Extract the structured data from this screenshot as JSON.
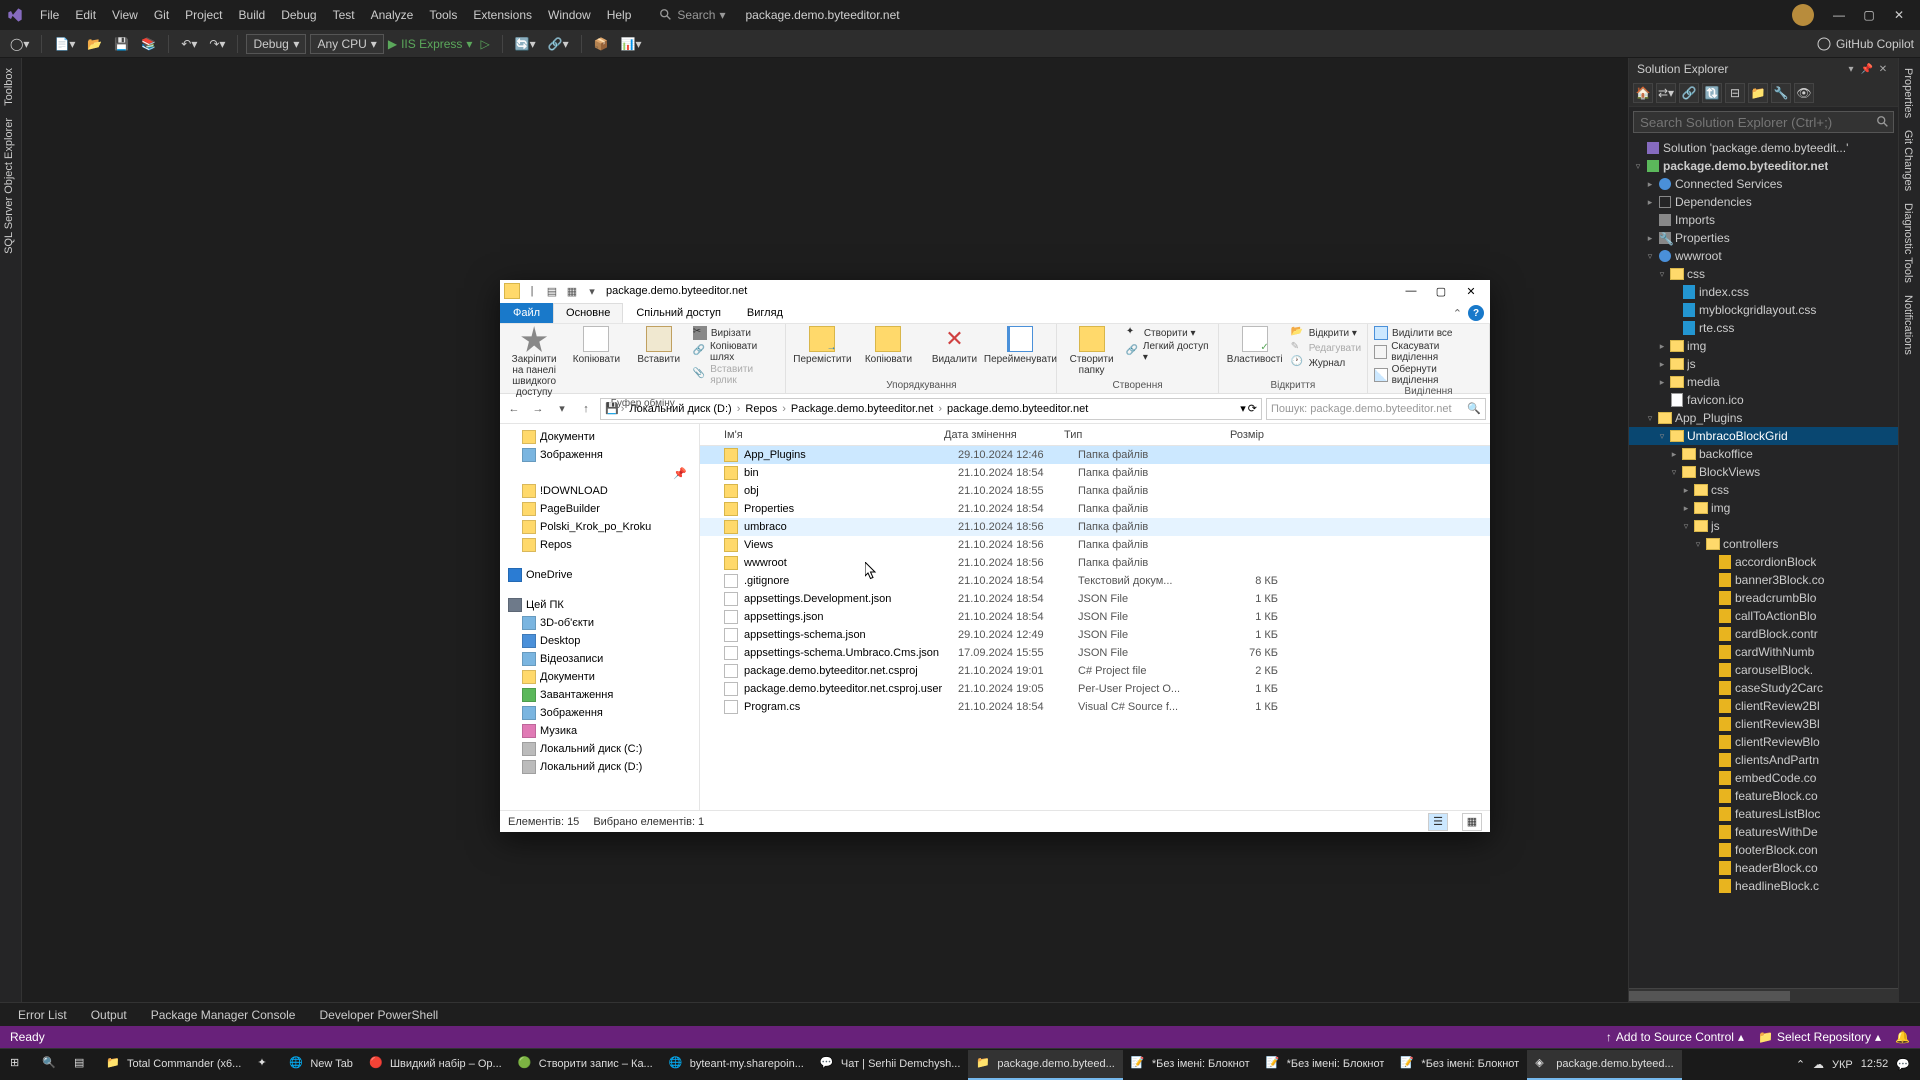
{
  "titlebar": {
    "menu": [
      "File",
      "Edit",
      "View",
      "Git",
      "Project",
      "Build",
      "Debug",
      "Test",
      "Analyze",
      "Tools",
      "Extensions",
      "Window",
      "Help"
    ],
    "search_label": "Search",
    "doc_title": "package.demo.byteeditor.net"
  },
  "toolbar": {
    "config": "Debug",
    "platform": "Any CPU",
    "run_target": "IIS Express",
    "copilot": "GitHub Copilot"
  },
  "left_tabs": [
    "Toolbox",
    "SQL Server Object Explorer"
  ],
  "right_tabs": [
    "Properties",
    "Git Changes",
    "Diagnostic Tools",
    "Notifications"
  ],
  "solexp": {
    "title": "Solution Explorer",
    "search_placeholder": "Search Solution Explorer (Ctrl+;)",
    "root": "Solution 'package.demo.byteedit...'",
    "project": "package.demo.byteeditor.net",
    "nodes": {
      "connected": "Connected Services",
      "deps": "Dependencies",
      "imports": "Imports",
      "properties": "Properties",
      "wwwroot": "wwwroot",
      "css": "css",
      "css_files": [
        "index.css",
        "myblockgridlayout.css",
        "rte.css"
      ],
      "img": "img",
      "js": "js",
      "media": "media",
      "favicon": "favicon.ico",
      "app_plugins": "App_Plugins",
      "umbraco_block": "UmbracoBlockGrid",
      "backoffice": "backoffice",
      "blockviews": "BlockViews",
      "bv_css": "css",
      "bv_img": "img",
      "bv_js": "js",
      "controllers": "controllers",
      "ctrl_files": [
        "accordionBlock",
        "banner3Block.co",
        "breadcrumbBlo",
        "callToActionBlo",
        "cardBlock.contr",
        "cardWithNumb",
        "carouselBlock.",
        "caseStudy2Carc",
        "clientReview2Bl",
        "clientReview3Bl",
        "clientReviewBlo",
        "clientsAndPartn",
        "embedCode.co",
        "featureBlock.co",
        "featuresListBloc",
        "featuresWithDe",
        "footerBlock.con",
        "headerBlock.co",
        "headlineBlock.c"
      ]
    }
  },
  "bottom_tabs": [
    "Error List",
    "Output",
    "Package Manager Console",
    "Developer PowerShell"
  ],
  "statusbar": {
    "ready": "Ready",
    "add_source": "Add to Source Control",
    "select_repo": "Select Repository"
  },
  "explorer": {
    "title": "package.demo.byteeditor.net",
    "tabs": {
      "file": "Файл",
      "home": "Основне",
      "share": "Спільний доступ",
      "view": "Вигляд"
    },
    "ribbon": {
      "g1": {
        "pin": "Закріпити на панелі\nшвидкого доступу",
        "copy": "Копіювати",
        "paste": "Вставити",
        "cut": "Вирізати",
        "copypath": "Копіювати шлях",
        "pasteshort": "Вставити ярлик",
        "name": "Буфер обміну"
      },
      "g2": {
        "move": "Перемістити",
        "copyto": "Копіювати",
        "delete": "Видалити",
        "rename": "Перейменувати",
        "name": "Упорядкування"
      },
      "g3": {
        "newfolder": "Створити\nпапку",
        "newitem": "Створити ▾",
        "easy": "Легкий доступ ▾",
        "name": "Створення"
      },
      "g4": {
        "props": "Властивості",
        "open": "Відкрити ▾",
        "edit": "Редагувати",
        "history": "Журнал",
        "name": "Відкриття"
      },
      "g5": {
        "selall": "Виділити все",
        "selnone": "Скасувати виділення",
        "selinv": "Обернути виділення",
        "name": "Виділення"
      }
    },
    "breadcrumb": [
      "Локальний диск (D:)",
      "Repos",
      "Package.demo.byteeditor.net",
      "package.demo.byteeditor.net"
    ],
    "search_placeholder": "Пошук: package.demo.byteeditor.net",
    "cols": {
      "name": "Ім'я",
      "date": "Дата змінення",
      "type": "Тип",
      "size": "Розмір"
    },
    "navpane": {
      "docs": "Документи",
      "images": "Зображення",
      "download": "!DOWNLOAD",
      "pagebuilder": "PageBuilder",
      "polski": "Polski_Krok_po_Kroku",
      "repos": "Repos",
      "onedrive": "OneDrive",
      "thispc": "Цей ПК",
      "3d": "3D-об'єкти",
      "desktop": "Desktop",
      "videos": "Відеозаписи",
      "docs2": "Документи",
      "downloads": "Завантаження",
      "pictures": "Зображення",
      "music": "Музика",
      "diskc": "Локальний диск (C:)",
      "diskd": "Локальний диск (D:)"
    },
    "files": [
      {
        "n": "App_Plugins",
        "d": "29.10.2024 12:46",
        "t": "Папка файлів",
        "s": "",
        "folder": true,
        "sel": true
      },
      {
        "n": "bin",
        "d": "21.10.2024 18:54",
        "t": "Папка файлів",
        "s": "",
        "folder": true
      },
      {
        "n": "obj",
        "d": "21.10.2024 18:55",
        "t": "Папка файлів",
        "s": "",
        "folder": true
      },
      {
        "n": "Properties",
        "d": "21.10.2024 18:54",
        "t": "Папка файлів",
        "s": "",
        "folder": true
      },
      {
        "n": "umbraco",
        "d": "21.10.2024 18:56",
        "t": "Папка файлів",
        "s": "",
        "folder": true,
        "hov": true
      },
      {
        "n": "Views",
        "d": "21.10.2024 18:56",
        "t": "Папка файлів",
        "s": "",
        "folder": true
      },
      {
        "n": "wwwroot",
        "d": "21.10.2024 18:56",
        "t": "Папка файлів",
        "s": "",
        "folder": true
      },
      {
        "n": ".gitignore",
        "d": "21.10.2024 18:54",
        "t": "Текстовий докум...",
        "s": "8 КБ",
        "folder": false
      },
      {
        "n": "appsettings.Development.json",
        "d": "21.10.2024 18:54",
        "t": "JSON File",
        "s": "1 КБ",
        "folder": false
      },
      {
        "n": "appsettings.json",
        "d": "21.10.2024 18:54",
        "t": "JSON File",
        "s": "1 КБ",
        "folder": false
      },
      {
        "n": "appsettings-schema.json",
        "d": "29.10.2024 12:49",
        "t": "JSON File",
        "s": "1 КБ",
        "folder": false
      },
      {
        "n": "appsettings-schema.Umbraco.Cms.json",
        "d": "17.09.2024 15:55",
        "t": "JSON File",
        "s": "76 КБ",
        "folder": false
      },
      {
        "n": "package.demo.byteeditor.net.csproj",
        "d": "21.10.2024 19:01",
        "t": "C# Project file",
        "s": "2 КБ",
        "folder": false
      },
      {
        "n": "package.demo.byteeditor.net.csproj.user",
        "d": "21.10.2024 19:05",
        "t": "Per-User Project O...",
        "s": "1 КБ",
        "folder": false
      },
      {
        "n": "Program.cs",
        "d": "21.10.2024 18:54",
        "t": "Visual C# Source f...",
        "s": "1 КБ",
        "folder": false
      }
    ],
    "status": {
      "items": "Елементів: 15",
      "selected": "Вибрано елементів: 1"
    }
  },
  "taskbar": {
    "items": [
      {
        "label": "",
        "icon": "windows"
      },
      {
        "label": "",
        "icon": "search"
      },
      {
        "label": "",
        "icon": "taskview"
      },
      {
        "label": "Total Commander (x6...",
        "icon": "tc"
      },
      {
        "label": "",
        "icon": "spark"
      },
      {
        "label": "New Tab",
        "icon": "edge"
      },
      {
        "label": "Швидкий набір – Op...",
        "icon": "opera"
      },
      {
        "label": "Створити запис – Ка...",
        "icon": "chrome"
      },
      {
        "label": "byteant-my.sharepoin...",
        "icon": "edge"
      },
      {
        "label": "Чат | Serhii Demchysh...",
        "icon": "teams"
      },
      {
        "label": "package.demo.byteed...",
        "icon": "folder",
        "active": true
      },
      {
        "label": "*Без імені: Блокнот",
        "icon": "notepad"
      },
      {
        "label": "*Без імені: Блокнот",
        "icon": "notepad"
      },
      {
        "label": "*Без імені: Блокнот",
        "icon": "notepad"
      },
      {
        "label": "package.demo.byteed...",
        "icon": "vs",
        "active": true
      }
    ],
    "time": "12:52",
    "lang": "УКР"
  }
}
